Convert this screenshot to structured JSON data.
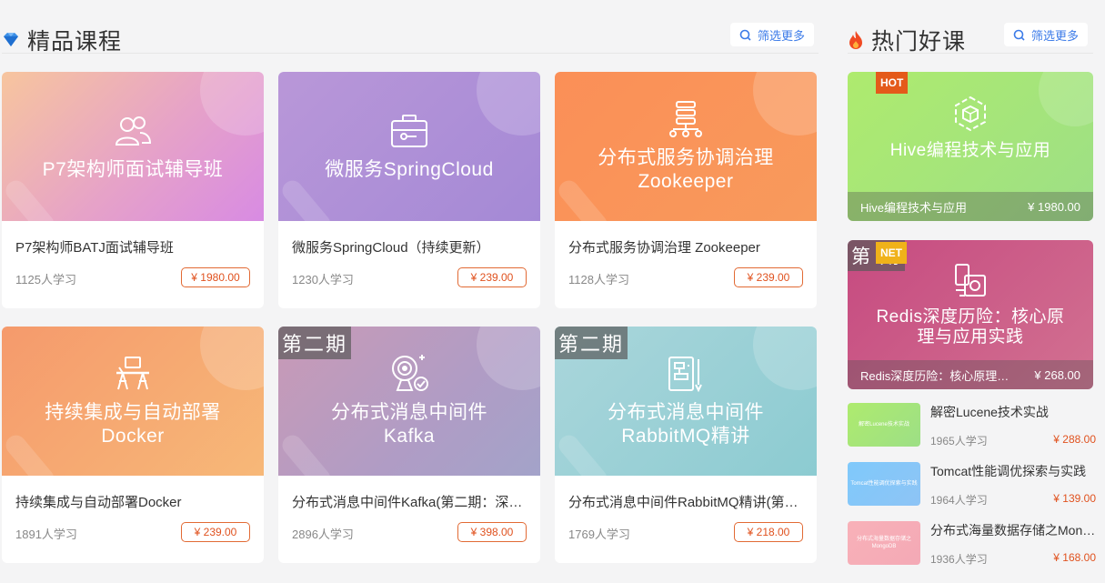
{
  "left_section": {
    "title": "精品课程",
    "filter_label": "筛选更多"
  },
  "right_section": {
    "title": "热门好课",
    "filter_label": "筛选更多"
  },
  "courses": [
    {
      "banner_line1": "P7架构师面试辅导班",
      "banner_line2": "",
      "tag": "",
      "title": "P7架构师BATJ面试辅导班",
      "count": "1125人学习",
      "price": "¥ 1980.00",
      "icon": "users-icon"
    },
    {
      "banner_line1": "微服务SpringCloud",
      "banner_line2": "",
      "tag": "",
      "title": "微服务SpringCloud（持续更新）",
      "count": "1230人学习",
      "price": "¥ 239.00",
      "icon": "toolbox-icon"
    },
    {
      "banner_line1": "分布式服务协调治理",
      "banner_line2": "Zookeeper",
      "tag": "",
      "title": "分布式服务协调治理 Zookeeper",
      "count": "1128人学习",
      "price": "¥ 239.00",
      "icon": "server-tree-icon"
    },
    {
      "banner_line1": "持续集成与自动部署",
      "banner_line2": "Docker",
      "tag": "",
      "title": "持续集成与自动部署Docker",
      "count": "1891人学习",
      "price": "¥ 239.00",
      "icon": "desk-icon"
    },
    {
      "banner_line1": "分布式消息中间件",
      "banner_line2": "Kafka",
      "tag": "第二期",
      "title": "分布式消息中间件Kafka(第二期：深入内核源码)",
      "count": "2896人学习",
      "price": "¥ 398.00",
      "icon": "webcam-icon"
    },
    {
      "banner_line1": "分布式消息中间件",
      "banner_line2": "RabbitMQ精讲",
      "tag": "第二期",
      "title": "分布式消息中间件RabbitMQ精讲(第二期)",
      "count": "1769人学习",
      "price": "¥ 218.00",
      "icon": "flowchart-icon"
    }
  ],
  "hot_courses": [
    {
      "badge": "HOT",
      "banner_line1": "Hive编程技术与应用",
      "banner_line2": "",
      "tag": "",
      "caption_title": "Hive编程技术与应用",
      "caption_price": "¥ 1980.00"
    },
    {
      "badge": "NET",
      "banner_line1": "Redis深度历险：核心原",
      "banner_line2": "理与应用实践",
      "tag": "第 期",
      "caption_title": "Redis深度历险：核心原理与应用实践",
      "caption_price": "¥ 268.00"
    }
  ],
  "mini_courses": [
    {
      "thumb_text": "解密Lucene技术实战",
      "title": "解密Lucene技术实战",
      "count": "1965人学习",
      "price": "¥ 288.00"
    },
    {
      "thumb_text": "Tomcat性能调优探索与实践",
      "title": "Tomcat性能调优探索与实践",
      "count": "1964人学习",
      "price": "¥ 139.00"
    },
    {
      "thumb_text": "分布式海量数据存储之MongoDB",
      "title": "分布式海量数据存储之MongoDB",
      "count": "1936人学习",
      "price": "¥ 168.00"
    }
  ],
  "colors": {
    "accent_blue": "#3c7be8",
    "price_orange": "#e0521f",
    "card1": [
      "#f7c59e",
      "#d88be3"
    ],
    "card2": [
      "#b997d8",
      "#a489d6"
    ],
    "card3": [
      "#fb9058",
      "#f79155"
    ],
    "card4": [
      "#f6a070",
      "#f7b577"
    ],
    "card5": [
      "#c89bb8",
      "#a7a0c8"
    ],
    "card6": [
      "#a6d4d9",
      "#8fccd2"
    ],
    "hot1": [
      "#a6e56f",
      "#9ddd88"
    ],
    "hot2": [
      "#c74e83",
      "#d06f8f"
    ],
    "mini1": [
      "#a7e96f",
      "#9ee08a"
    ],
    "mini2": [
      "#7fc9fb",
      "#8ec4f5"
    ],
    "mini3": [
      "#f8b1b8",
      "#f4a9b6"
    ]
  }
}
